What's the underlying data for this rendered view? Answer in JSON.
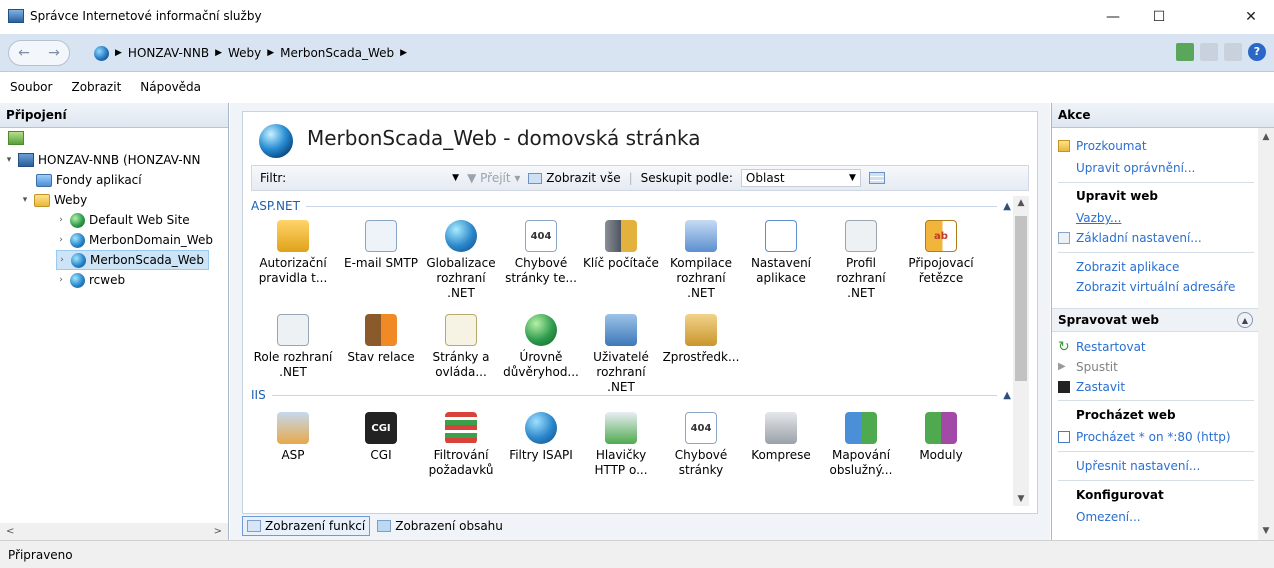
{
  "window": {
    "title": "Správce Internetové informační služby",
    "minimize": "—",
    "maximize": "☐",
    "close": "✕"
  },
  "address": {
    "back": "←",
    "forward": "→",
    "segments": [
      "HONZAV-NNB",
      "Weby",
      "MerbonScada_Web"
    ]
  },
  "menu": {
    "file": "Soubor",
    "view": "Zobrazit",
    "help": "Nápověda"
  },
  "connections": {
    "header": "Připojení",
    "tree": {
      "server": "HONZAV-NNB (HONZAV-NN",
      "app_pools": "Fondy aplikací",
      "sites": "Weby",
      "site_items": [
        "Default Web Site",
        "MerbonDomain_Web",
        "MerbonScada_Web",
        "rcweb"
      ]
    }
  },
  "main": {
    "title": "MerbonScada_Web - domovská stránka",
    "filter_label": "Filtr:",
    "go": "Přejít",
    "show_all": "Zobrazit vše",
    "group_by": "Seskupit podle:",
    "group_value": "Oblast",
    "groups": {
      "aspnet": {
        "label": "ASP.NET",
        "features": [
          "Autorizační pravidla t...",
          "E-mail SMTP",
          "Globalizace rozhraní .NET",
          "Chybové stránky te...",
          "Klíč počítače",
          "Kompilace rozhraní .NET",
          "Nastavení aplikace",
          "Profil rozhraní .NET",
          "Připojovací řetězce",
          "Role rozhraní .NET",
          "Stav relace",
          "Stránky a ovláda...",
          "Úrovně důvěryhod...",
          "Uživatelé rozhraní .NET",
          "Zprostředk..."
        ]
      },
      "iis": {
        "label": "IIS",
        "features": [
          "ASP",
          "CGI",
          "Filtrování požadavků",
          "Filtry ISAPI",
          "Hlavičky HTTP o...",
          "Chybové stránky",
          "Komprese",
          "Mapování obslužný...",
          "Moduly"
        ]
      }
    },
    "tabs": {
      "features": "Zobrazení funkcí",
      "content": "Zobrazení obsahu"
    }
  },
  "actions": {
    "header": "Akce",
    "explore": "Prozkoumat",
    "edit_perms": "Upravit oprávnění...",
    "edit_site": "Upravit web",
    "bindings": "Vazby...",
    "basic_settings": "Základní nastavení...",
    "view_apps": "Zobrazit aplikace",
    "view_vdirs": "Zobrazit virtuální adresáře",
    "manage_site": "Spravovat web",
    "restart": "Restartovat",
    "start": "Spustit",
    "stop": "Zastavit",
    "browse_site": "Procházet web",
    "browse_link": "Procházet * on *:80 (http)",
    "advanced": "Upřesnit nastavení...",
    "configure": "Konfigurovat",
    "limits": "Omezení..."
  },
  "status": {
    "text": "Připraveno"
  }
}
